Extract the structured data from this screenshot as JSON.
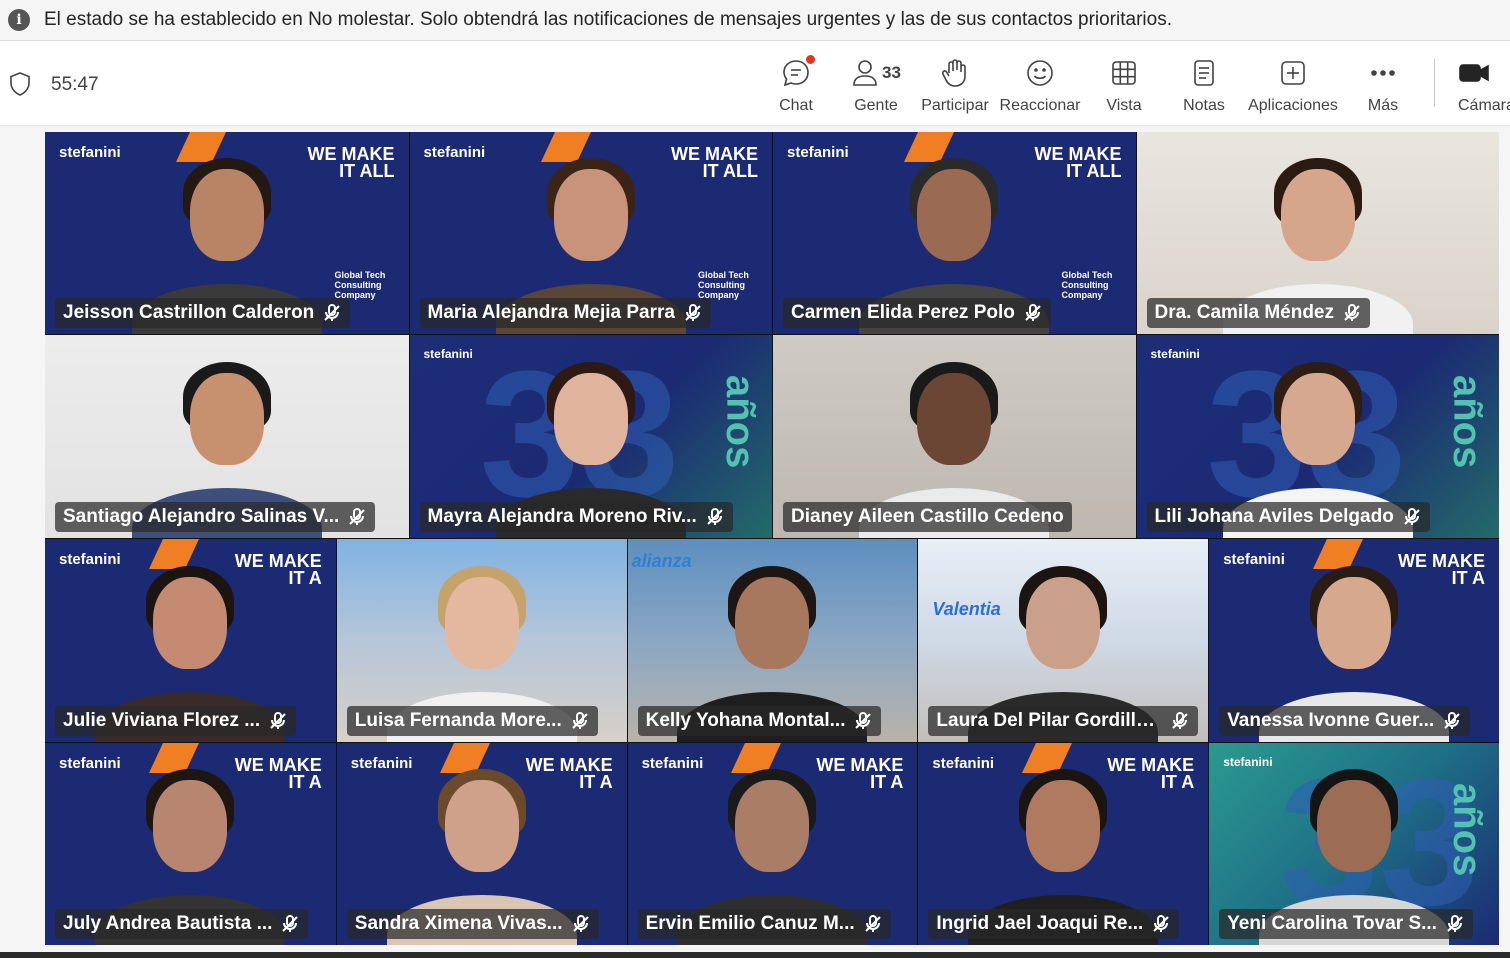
{
  "banner": {
    "icon": "info-icon",
    "message": "El estado se ha establecido en No molestar. Solo obtendrá las notificaciones de mensajes urgentes y las de sus contactos prioritarios."
  },
  "toolbar": {
    "timer": "55:47",
    "buttons": [
      {
        "label": "Chat",
        "icon": "chat-icon",
        "badge": "red-dot"
      },
      {
        "label": "Gente",
        "icon": "people-icon",
        "count": "33"
      },
      {
        "label": "Participar",
        "icon": "raise-hand-icon"
      },
      {
        "label": "Reaccionar",
        "icon": "smiley-icon"
      },
      {
        "label": "Vista",
        "icon": "grid-view-icon"
      },
      {
        "label": "Notas",
        "icon": "notes-icon"
      },
      {
        "label": "Aplicaciones",
        "icon": "add-app-icon"
      },
      {
        "label": "Más",
        "icon": "more-icon"
      },
      {
        "label": "Cámara",
        "icon": "camera-icon"
      }
    ]
  },
  "participants": [
    {
      "name": "Jeisson Castrillon Calderon"
    },
    {
      "name": "Maria Alejandra Mejia Parra"
    },
    {
      "name": "Carmen Elida Perez Polo"
    },
    {
      "name": "Dra. Camila Méndez"
    },
    {
      "name": "Santiago Alejandro Salinas V..."
    },
    {
      "name": "Mayra Alejandra Moreno Riv..."
    },
    {
      "name": "Dianey Aileen Castillo Cedeno"
    },
    {
      "name": "Lili Johana Aviles Delgado"
    },
    {
      "name": "Julie Viviana Florez ..."
    },
    {
      "name": "Luisa Fernanda More..."
    },
    {
      "name": "Kelly Yohana Montal..."
    },
    {
      "name": "Laura Del Pilar Gordillo ..."
    },
    {
      "name": "Vanessa Ivonne Guer..."
    },
    {
      "name": "July Andrea Bautista ..."
    },
    {
      "name": "Sandra Ximena Vivas..."
    },
    {
      "name": "Ervin Emilio Canuz M..."
    },
    {
      "name": "Ingrid Jael Joaqui Re..."
    },
    {
      "name": "Yeni Carolina Tovar S..."
    }
  ],
  "backgrounds": {
    "brand_logo": "stefanini",
    "brand_tagline_1": "WE MAKE",
    "brand_tagline_2": "IT ALL",
    "brand_tagline_short": "IT A",
    "brand_company": "Global Tech Consulting Company",
    "anniversary_number": "33",
    "anniversary_word": "años",
    "office_sign_1": "Valentia",
    "office_sign_2": "alianza"
  },
  "colors": {
    "brand_blue": "#1b2a73",
    "brand_orange": "#f07f23",
    "teal": "#53c2b1",
    "badge_red": "#e3361c"
  }
}
